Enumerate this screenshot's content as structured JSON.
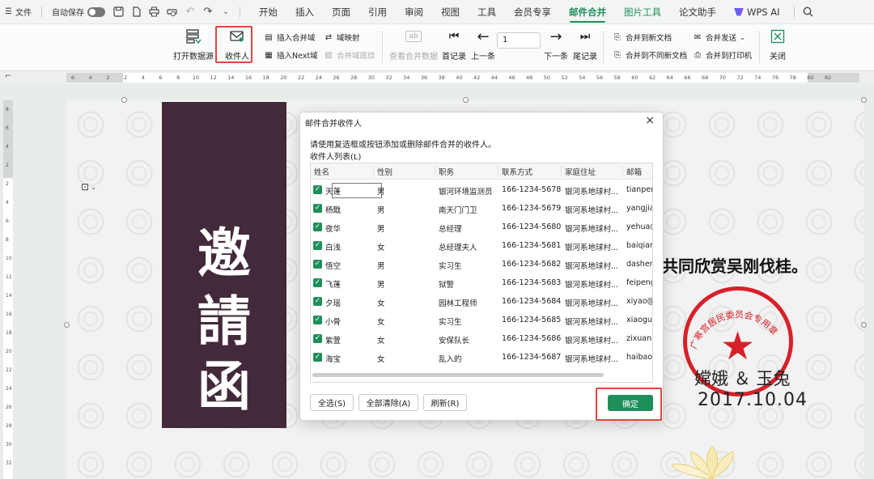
{
  "menubar": {
    "file": "文件",
    "autosave": "自动保存",
    "tabs": [
      "开始",
      "插入",
      "页面",
      "引用",
      "审阅",
      "视图",
      "工具",
      "会员专享",
      "邮件合并",
      "图片工具",
      "论文助手",
      "WPS AI"
    ],
    "active_tab": "邮件合并"
  },
  "ribbon": {
    "open_datasource": "打开数据源",
    "recipients": "收件人",
    "insert_merge_field": "插入合并域",
    "insert_next_field": "插入Next域",
    "field_mapping": "域映射",
    "merge_field_shading": "合并域底纹",
    "view_merged_data": "查看合并数据",
    "first_record": "首记录",
    "prev_record": "上一条",
    "record_number": "1",
    "next_record": "下一条",
    "last_record": "尾记录",
    "merge_to_new_doc": "合并到新文档",
    "merge_to_diff_docs": "合并到不同新文档",
    "merge_send": "合并发送",
    "merge_to_printer": "合并到打印机",
    "close": "关闭"
  },
  "ruler": {
    "ticks": [
      "6",
      "4",
      "2",
      "2",
      "4",
      "6",
      "8",
      "10",
      "12",
      "14",
      "16",
      "18",
      "20",
      "22",
      "24",
      "26",
      "28",
      "30",
      "32",
      "34",
      "36",
      "38",
      "40",
      "42",
      "44",
      "46",
      "48",
      "50",
      "52",
      "54",
      "56",
      "58",
      "60",
      "62",
      "64",
      "66",
      "68",
      "70",
      "72",
      "74",
      "76",
      "78",
      "80",
      "82"
    ],
    "vticks": [
      "8",
      "6",
      "4",
      "2",
      "2",
      "4",
      "6",
      "8",
      "10",
      "12",
      "14",
      "16",
      "18",
      "20",
      "22",
      "24",
      "26",
      "28",
      "30",
      "32"
    ]
  },
  "document": {
    "banner_chars": [
      "邀",
      "請",
      "函"
    ],
    "invite_text": "共同欣赏吴刚伐桂。",
    "seal_text": "广寒宫居民委员会专用章",
    "seal_star": "★",
    "signer": "嫦娥 ＆ 玉兔",
    "date": "2017.10.04"
  },
  "dialog": {
    "title": "邮件合并收件人",
    "description": "请使用复选框或按钮添加或删除邮件合并的收件人。",
    "list_label": "收件人列表(L)",
    "columns": [
      "姓名",
      "性别",
      "职务",
      "联系方式",
      "家庭住址",
      "邮箱"
    ],
    "rows": [
      {
        "name": "天蓬",
        "gender": "男",
        "title": "银河环境监测员",
        "phone": "166-1234-5678",
        "address": "银河系地球村...",
        "email": "tianper"
      },
      {
        "name": "杨戬",
        "gender": "男",
        "title": "南天门门卫",
        "phone": "166-1234-5679",
        "address": "银河系地球村...",
        "email": "yangjia"
      },
      {
        "name": "夜华",
        "gender": "男",
        "title": "总经理",
        "phone": "166-1234-5680",
        "address": "银河系地球村...",
        "email": "yehua@"
      },
      {
        "name": "白浅",
        "gender": "女",
        "title": "总经理夫人",
        "phone": "166-1234-5681",
        "address": "银河系地球村...",
        "email": "baiqian"
      },
      {
        "name": "悟空",
        "gender": "男",
        "title": "实习生",
        "phone": "166-1234-5682",
        "address": "银河系地球村...",
        "email": "dashen"
      },
      {
        "name": "飞蓬",
        "gender": "男",
        "title": "狱警",
        "phone": "166-1234-5683",
        "address": "银河系地球村...",
        "email": "feipeng"
      },
      {
        "name": "夕瑶",
        "gender": "女",
        "title": "园林工程师",
        "phone": "166-1234-5684",
        "address": "银河系地球村...",
        "email": "xiyao@"
      },
      {
        "name": "小骨",
        "gender": "女",
        "title": "实习生",
        "phone": "166-1234-5685",
        "address": "银河系地球村...",
        "email": "xiaoguc"
      },
      {
        "name": "紫萱",
        "gender": "女",
        "title": "安保队长",
        "phone": "166-1234-5686",
        "address": "银河系地球村...",
        "email": "zixuan@"
      },
      {
        "name": "海宝",
        "gender": "女",
        "title": "乱入的",
        "phone": "166-1234-5687",
        "address": "银河系地球村...",
        "email": "haibao"
      }
    ],
    "select_all": "全选(S)",
    "clear_all": "全部清除(A)",
    "refresh": "刷新(R)",
    "ok": "确定"
  },
  "colors": {
    "accent": "#1f8f5a",
    "highlight_box": "#e0463f",
    "banner": "#422a3a",
    "seal": "#d7202a"
  }
}
